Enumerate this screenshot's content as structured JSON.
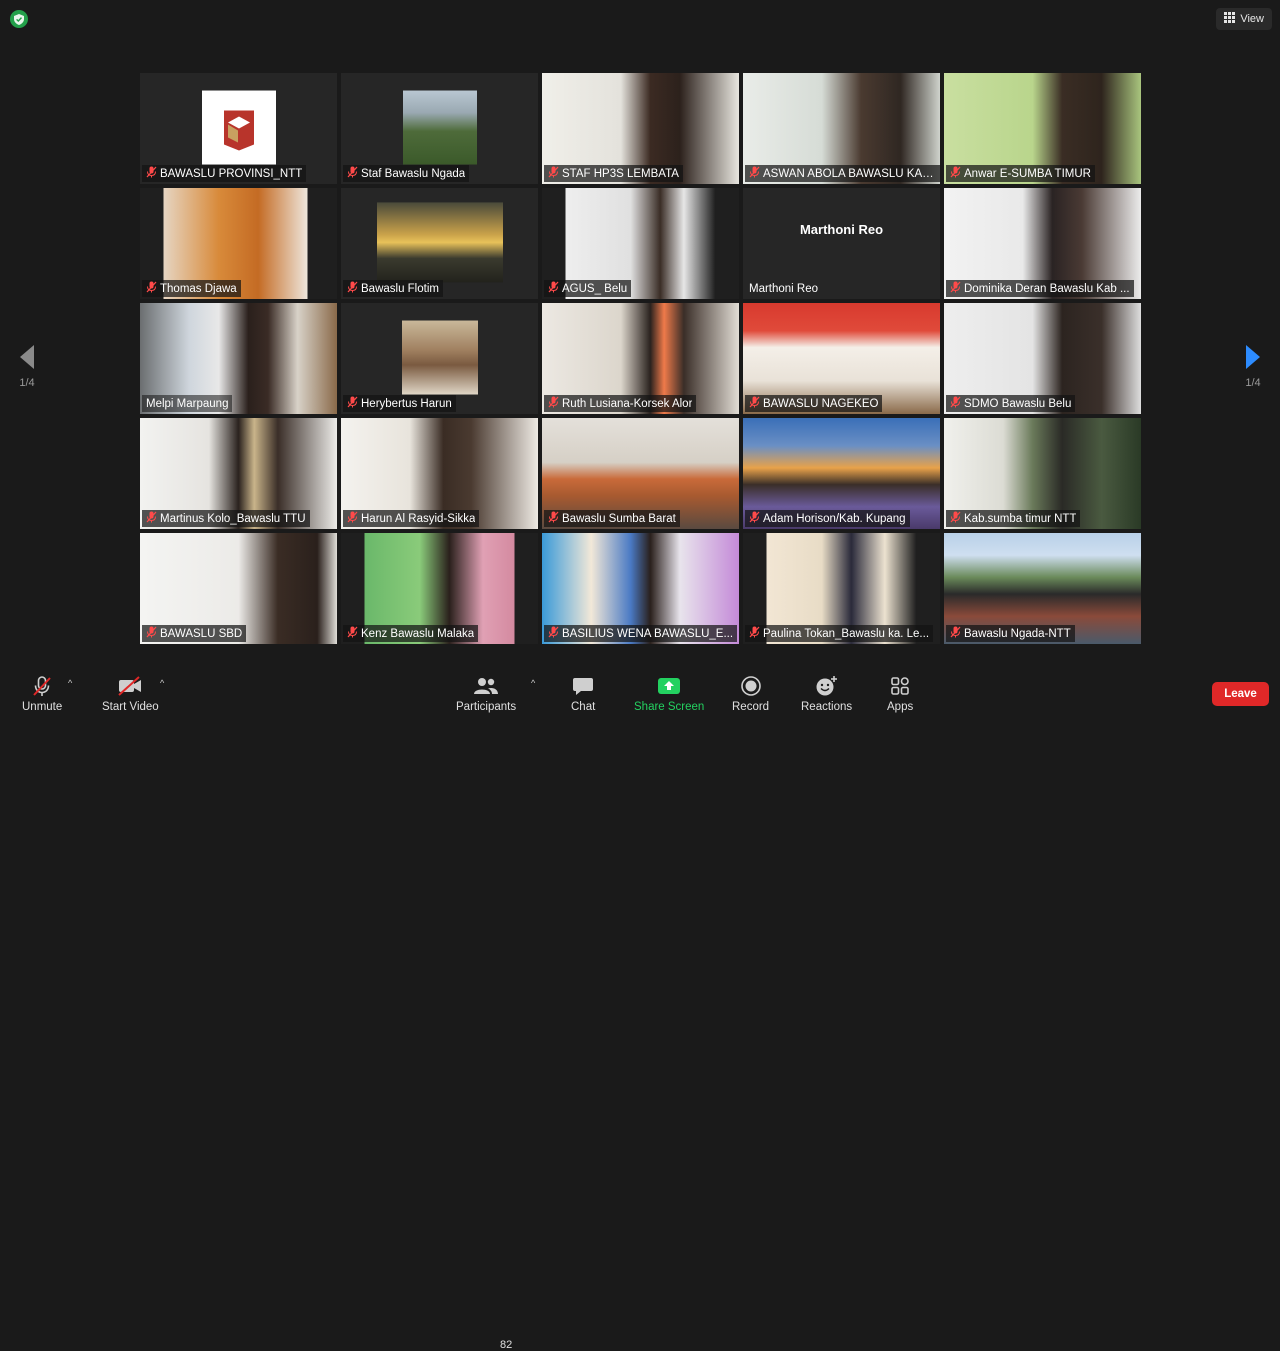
{
  "top": {
    "view_label": "View"
  },
  "pagination": {
    "left": "1/4",
    "right": "1/4"
  },
  "tiles": [
    {
      "name": "BAWASLU PROVINSI_NTT"
    },
    {
      "name": "Staf Bawaslu Ngada"
    },
    {
      "name": "STAF HP3S LEMBATA"
    },
    {
      "name": "ASWAN ABOLA BAWASLU KAB..."
    },
    {
      "name": "Anwar E-SUMBA TIMUR"
    },
    {
      "name": "Thomas Djawa"
    },
    {
      "name": "Bawaslu Flotim"
    },
    {
      "name": "AGUS_ Belu"
    },
    {
      "name": "Marthoni Reo",
      "display_name": "Marthoni Reo"
    },
    {
      "name": "Dominika Deran Bawaslu Kab ..."
    },
    {
      "name": "Melpi Marpaung"
    },
    {
      "name": "Herybertus Harun"
    },
    {
      "name": "Ruth Lusiana-Korsek Alor"
    },
    {
      "name": "BAWASLU NAGEKEO"
    },
    {
      "name": "SDMO Bawaslu Belu"
    },
    {
      "name": "Martinus Kolo_Bawaslu TTU"
    },
    {
      "name": "Harun Al Rasyid-Sikka"
    },
    {
      "name": "Bawaslu Sumba Barat"
    },
    {
      "name": "Adam Horison/Kab. Kupang"
    },
    {
      "name": "Kab.sumba timur NTT"
    },
    {
      "name": "BAWASLU SBD"
    },
    {
      "name": "Kenz Bawaslu Malaka"
    },
    {
      "name": "BASILIUS WENA BAWASLU_E..."
    },
    {
      "name": "Paulina Tokan_Bawaslu ka. Le..."
    },
    {
      "name": "Bawaslu Ngada-NTT"
    }
  ],
  "toolbar": {
    "unmute": "Unmute",
    "start_video": "Start Video",
    "participants": "Participants",
    "participants_count": "82",
    "chat": "Chat",
    "share_screen": "Share Screen",
    "record": "Record",
    "reactions": "Reactions",
    "apps": "Apps",
    "leave": "Leave"
  },
  "colors": {
    "accent_green": "#23d160",
    "leave_red": "#e02828",
    "active_speaker": "#b5e02a",
    "nav_blue": "#2d8cff"
  }
}
